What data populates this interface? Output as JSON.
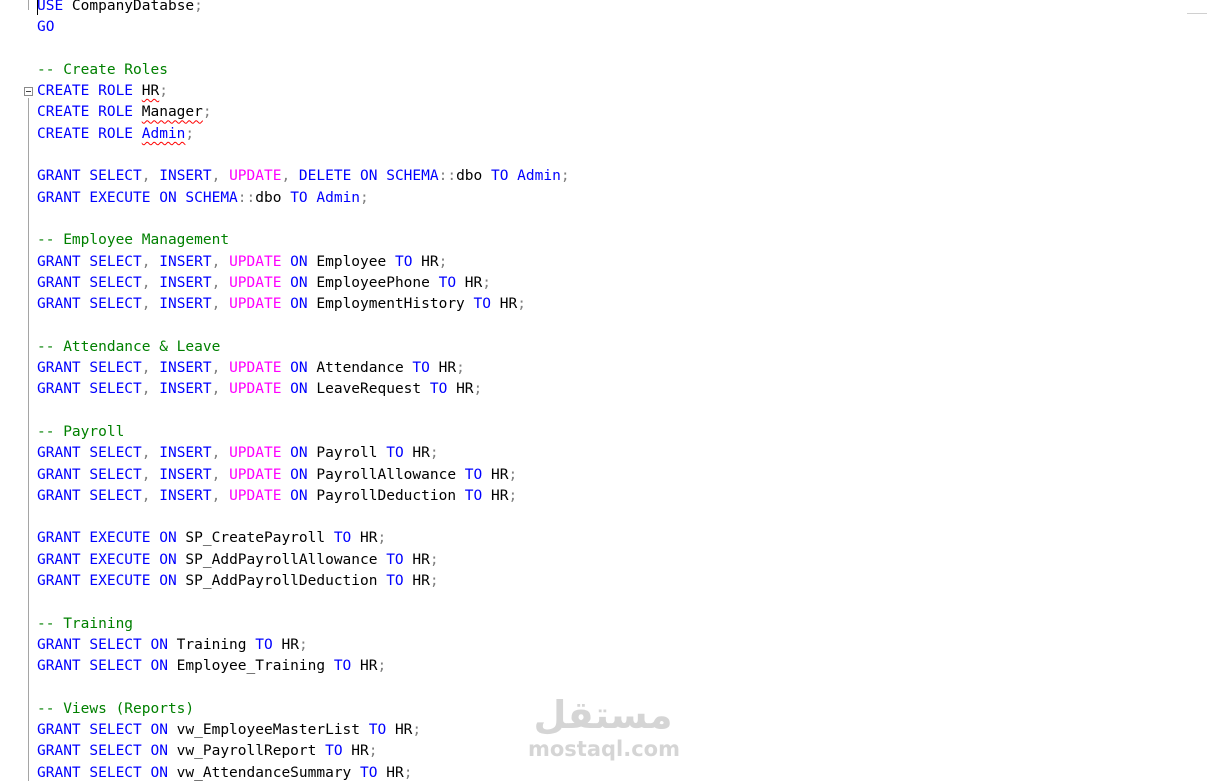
{
  "editor": {
    "lines": [
      [
        {
          "t": "USE",
          "c": "kw"
        },
        {
          "t": " CompanyDatabse"
        },
        {
          "t": ";",
          "c": "op"
        }
      ],
      [
        {
          "t": "GO",
          "c": "kw"
        }
      ],
      [],
      [
        {
          "t": "-- Create Roles",
          "c": "cm"
        }
      ],
      [
        {
          "t": "CREATE ROLE",
          "c": "kw"
        },
        {
          "t": " "
        },
        {
          "t": "HR",
          "c": "err"
        },
        {
          "t": ";",
          "c": "op"
        }
      ],
      [
        {
          "t": "CREATE ROLE",
          "c": "kw"
        },
        {
          "t": " "
        },
        {
          "t": "Manager",
          "c": "err"
        },
        {
          "t": ";",
          "c": "op"
        }
      ],
      [
        {
          "t": "CREATE ROLE",
          "c": "kw"
        },
        {
          "t": " "
        },
        {
          "t": "Admin",
          "c": "kw err"
        },
        {
          "t": ";",
          "c": "op"
        }
      ],
      [],
      [
        {
          "t": "GRANT SELECT",
          "c": "kw"
        },
        {
          "t": ",",
          "c": "op"
        },
        {
          "t": " INSERT",
          "c": "kw"
        },
        {
          "t": ",",
          "c": "op"
        },
        {
          "t": " UPDATE",
          "c": "fn"
        },
        {
          "t": ",",
          "c": "op"
        },
        {
          "t": " DELETE ON SCHEMA",
          "c": "kw"
        },
        {
          "t": "::",
          "c": "op"
        },
        {
          "t": "dbo "
        },
        {
          "t": "TO Admin",
          "c": "kw"
        },
        {
          "t": ";",
          "c": "op"
        }
      ],
      [
        {
          "t": "GRANT EXECUTE ON SCHEMA",
          "c": "kw"
        },
        {
          "t": "::",
          "c": "op"
        },
        {
          "t": "dbo "
        },
        {
          "t": "TO Admin",
          "c": "kw"
        },
        {
          "t": ";",
          "c": "op"
        }
      ],
      [],
      [
        {
          "t": "-- Employee Management",
          "c": "cm"
        }
      ],
      [
        {
          "t": "GRANT SELECT",
          "c": "kw"
        },
        {
          "t": ",",
          "c": "op"
        },
        {
          "t": " INSERT",
          "c": "kw"
        },
        {
          "t": ",",
          "c": "op"
        },
        {
          "t": " UPDATE",
          "c": "fn"
        },
        {
          "t": " ON",
          "c": "kw"
        },
        {
          "t": " Employee "
        },
        {
          "t": "TO",
          "c": "kw"
        },
        {
          "t": " HR"
        },
        {
          "t": ";",
          "c": "op"
        }
      ],
      [
        {
          "t": "GRANT SELECT",
          "c": "kw"
        },
        {
          "t": ",",
          "c": "op"
        },
        {
          "t": " INSERT",
          "c": "kw"
        },
        {
          "t": ",",
          "c": "op"
        },
        {
          "t": " UPDATE",
          "c": "fn"
        },
        {
          "t": " ON",
          "c": "kw"
        },
        {
          "t": " EmployeePhone "
        },
        {
          "t": "TO",
          "c": "kw"
        },
        {
          "t": " HR"
        },
        {
          "t": ";",
          "c": "op"
        }
      ],
      [
        {
          "t": "GRANT SELECT",
          "c": "kw"
        },
        {
          "t": ",",
          "c": "op"
        },
        {
          "t": " INSERT",
          "c": "kw"
        },
        {
          "t": ",",
          "c": "op"
        },
        {
          "t": " UPDATE",
          "c": "fn"
        },
        {
          "t": " ON",
          "c": "kw"
        },
        {
          "t": " EmploymentHistory "
        },
        {
          "t": "TO",
          "c": "kw"
        },
        {
          "t": " HR"
        },
        {
          "t": ";",
          "c": "op"
        }
      ],
      [],
      [
        {
          "t": "-- Attendance & Leave",
          "c": "cm"
        }
      ],
      [
        {
          "t": "GRANT SELECT",
          "c": "kw"
        },
        {
          "t": ",",
          "c": "op"
        },
        {
          "t": " INSERT",
          "c": "kw"
        },
        {
          "t": ",",
          "c": "op"
        },
        {
          "t": " UPDATE",
          "c": "fn"
        },
        {
          "t": " ON",
          "c": "kw"
        },
        {
          "t": " Attendance "
        },
        {
          "t": "TO",
          "c": "kw"
        },
        {
          "t": " HR"
        },
        {
          "t": ";",
          "c": "op"
        }
      ],
      [
        {
          "t": "GRANT SELECT",
          "c": "kw"
        },
        {
          "t": ",",
          "c": "op"
        },
        {
          "t": " INSERT",
          "c": "kw"
        },
        {
          "t": ",",
          "c": "op"
        },
        {
          "t": " UPDATE",
          "c": "fn"
        },
        {
          "t": " ON",
          "c": "kw"
        },
        {
          "t": " LeaveRequest "
        },
        {
          "t": "TO",
          "c": "kw"
        },
        {
          "t": " HR"
        },
        {
          "t": ";",
          "c": "op"
        }
      ],
      [],
      [
        {
          "t": "-- Payroll",
          "c": "cm"
        }
      ],
      [
        {
          "t": "GRANT SELECT",
          "c": "kw"
        },
        {
          "t": ",",
          "c": "op"
        },
        {
          "t": " INSERT",
          "c": "kw"
        },
        {
          "t": ",",
          "c": "op"
        },
        {
          "t": " UPDATE",
          "c": "fn"
        },
        {
          "t": " ON",
          "c": "kw"
        },
        {
          "t": " Payroll "
        },
        {
          "t": "TO",
          "c": "kw"
        },
        {
          "t": " HR"
        },
        {
          "t": ";",
          "c": "op"
        }
      ],
      [
        {
          "t": "GRANT SELECT",
          "c": "kw"
        },
        {
          "t": ",",
          "c": "op"
        },
        {
          "t": " INSERT",
          "c": "kw"
        },
        {
          "t": ",",
          "c": "op"
        },
        {
          "t": " UPDATE",
          "c": "fn"
        },
        {
          "t": " ON",
          "c": "kw"
        },
        {
          "t": " PayrollAllowance "
        },
        {
          "t": "TO",
          "c": "kw"
        },
        {
          "t": " HR"
        },
        {
          "t": ";",
          "c": "op"
        }
      ],
      [
        {
          "t": "GRANT SELECT",
          "c": "kw"
        },
        {
          "t": ",",
          "c": "op"
        },
        {
          "t": " INSERT",
          "c": "kw"
        },
        {
          "t": ",",
          "c": "op"
        },
        {
          "t": " UPDATE",
          "c": "fn"
        },
        {
          "t": " ON",
          "c": "kw"
        },
        {
          "t": " PayrollDeduction "
        },
        {
          "t": "TO",
          "c": "kw"
        },
        {
          "t": " HR"
        },
        {
          "t": ";",
          "c": "op"
        }
      ],
      [],
      [
        {
          "t": "GRANT EXECUTE ON",
          "c": "kw"
        },
        {
          "t": " SP_CreatePayroll "
        },
        {
          "t": "TO",
          "c": "kw"
        },
        {
          "t": " HR"
        },
        {
          "t": ";",
          "c": "op"
        }
      ],
      [
        {
          "t": "GRANT EXECUTE ON",
          "c": "kw"
        },
        {
          "t": " SP_AddPayrollAllowance "
        },
        {
          "t": "TO",
          "c": "kw"
        },
        {
          "t": " HR"
        },
        {
          "t": ";",
          "c": "op"
        }
      ],
      [
        {
          "t": "GRANT EXECUTE ON",
          "c": "kw"
        },
        {
          "t": " SP_AddPayrollDeduction "
        },
        {
          "t": "TO",
          "c": "kw"
        },
        {
          "t": " HR"
        },
        {
          "t": ";",
          "c": "op"
        }
      ],
      [],
      [
        {
          "t": "-- Training",
          "c": "cm"
        }
      ],
      [
        {
          "t": "GRANT SELECT ON",
          "c": "kw"
        },
        {
          "t": " Training "
        },
        {
          "t": "TO",
          "c": "kw"
        },
        {
          "t": " HR"
        },
        {
          "t": ";",
          "c": "op"
        }
      ],
      [
        {
          "t": "GRANT SELECT ON",
          "c": "kw"
        },
        {
          "t": " Employee_Training "
        },
        {
          "t": "TO",
          "c": "kw"
        },
        {
          "t": " HR"
        },
        {
          "t": ";",
          "c": "op"
        }
      ],
      [],
      [
        {
          "t": "-- Views (Reports)",
          "c": "cm"
        }
      ],
      [
        {
          "t": "GRANT SELECT ON",
          "c": "kw"
        },
        {
          "t": " vw_EmployeeMasterList "
        },
        {
          "t": "TO",
          "c": "kw"
        },
        {
          "t": " HR"
        },
        {
          "t": ";",
          "c": "op"
        }
      ],
      [
        {
          "t": "GRANT SELECT ON",
          "c": "kw"
        },
        {
          "t": " vw_PayrollReport "
        },
        {
          "t": "TO",
          "c": "kw"
        },
        {
          "t": " HR"
        },
        {
          "t": ";",
          "c": "op"
        }
      ],
      [
        {
          "t": "GRANT SELECT ON",
          "c": "kw"
        },
        {
          "t": " vw_AttendanceSummary "
        },
        {
          "t": "TO",
          "c": "kw"
        },
        {
          "t": " HR"
        },
        {
          "t": ";",
          "c": "op"
        }
      ]
    ],
    "fold_marker_line": 4
  },
  "watermark": {
    "arabic": "مستقل",
    "latin": "mostaql.com"
  },
  "colors": {
    "keyword": "#0000ff",
    "function": "#ff00ff",
    "comment": "#008000",
    "operator": "#808080",
    "text": "#000000",
    "error_squiggle": "#ff0000"
  }
}
